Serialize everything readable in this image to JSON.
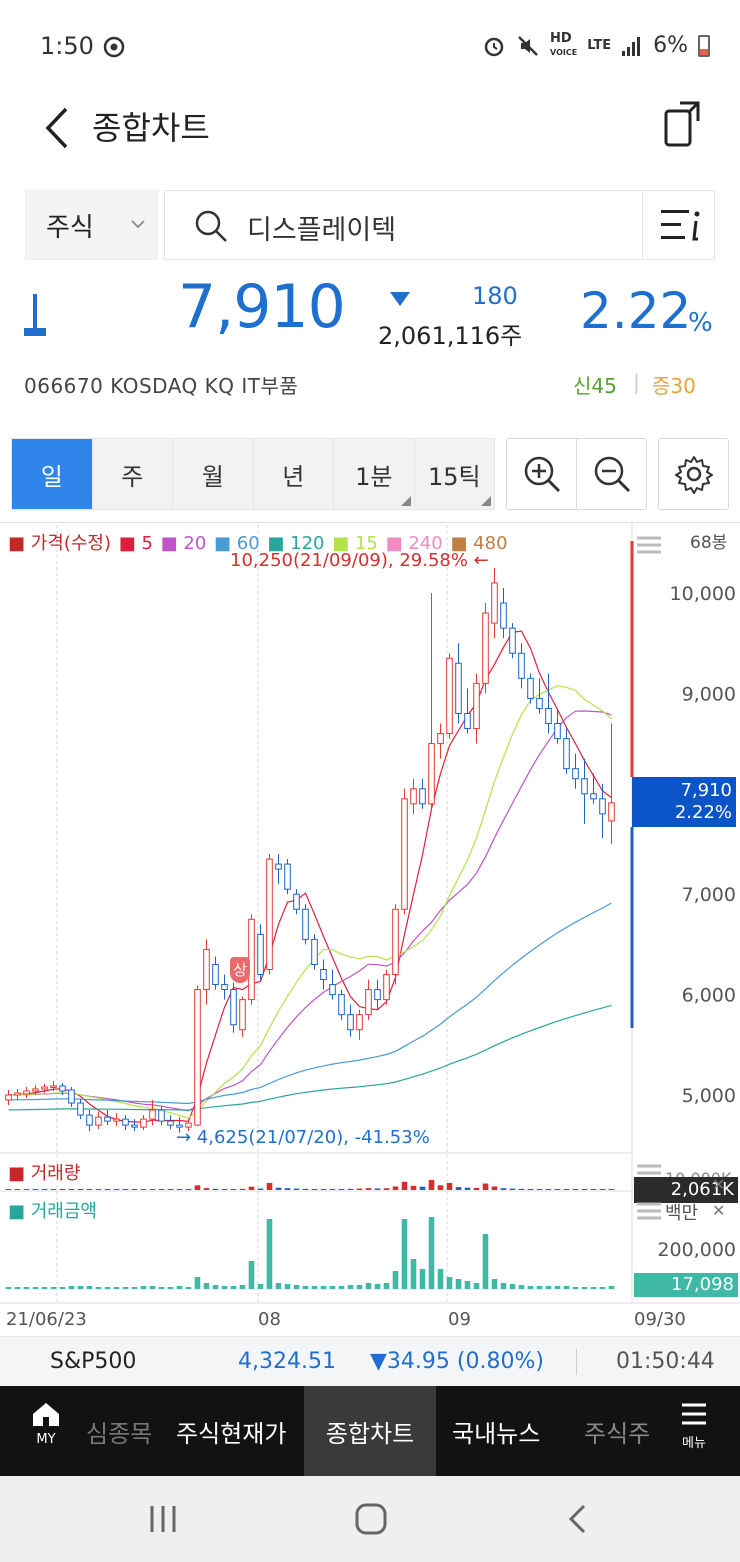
{
  "status_bar": {
    "time": "1:50",
    "battery": "6%",
    "network": "LTE"
  },
  "header": {
    "title": "종합차트"
  },
  "search": {
    "type_label": "주식",
    "query": "디스플레이텍"
  },
  "quote": {
    "price": "7,910",
    "change": "180",
    "volume": "2,061,116주",
    "percent": "2.22",
    "percent_sign": "%",
    "code_line": "066670  KOSDAQ  KQ IT부품",
    "new_high": "신45",
    "divider": "|",
    "margin": "증30"
  },
  "period_tabs": [
    {
      "label": "일",
      "active": true
    },
    {
      "label": "주"
    },
    {
      "label": "월"
    },
    {
      "label": "년"
    },
    {
      "label": "1분",
      "corner": true
    },
    {
      "label": "15틱",
      "corner": true
    }
  ],
  "chart_labels": {
    "legend": [
      {
        "text": "■ 가격(수정)",
        "color": "#c62828"
      },
      {
        "text": "■ 5",
        "color": "#e01e3c"
      },
      {
        "text": "■ 20",
        "color": "#c054c8"
      },
      {
        "text": "■ 60",
        "color": "#4a9ad4"
      },
      {
        "text": "■ 120",
        "color": "#27a79b"
      },
      {
        "text": "■ 15",
        "color": "#b3e34a"
      },
      {
        "text": "■ 240",
        "color": "#f08bc4"
      },
      {
        "text": "■ 480",
        "color": "#c08040"
      }
    ],
    "bong_count": "68봉",
    "high_annotation": "10,250(21/09/09), 29.58%  ←",
    "low_annotation": "→  4,625(21/07/20), -41.53%",
    "limit_up_badge": "상",
    "volume_label": "■ 거래량",
    "amount_label": "■ 거래금액",
    "amount_unit": "백만",
    "vol_axis_partial": "10,000K",
    "current_price_tag": "7,910",
    "current_pct_tag": "2.22%",
    "current_vol_tag": "2,061K",
    "current_amt_tag": "17,098",
    "x_labels": [
      "21/06/23",
      "08",
      "09",
      "09/30"
    ]
  },
  "chart_data": {
    "type": "candlestick",
    "title": "",
    "ylim": [
      4500,
      10500
    ],
    "yticks": [
      5000,
      6000,
      7000,
      8000,
      9000,
      10000
    ],
    "ytick_labels": [
      "5,000",
      "6,000",
      "7,000",
      "",
      "9,000",
      "10,000"
    ],
    "amount_ticks": [
      200000
    ],
    "amount_tick_labels": [
      "200,000"
    ],
    "candles": [
      [
        4950,
        5050,
        4900,
        5000
      ],
      [
        5000,
        5060,
        4950,
        5020
      ],
      [
        5010,
        5080,
        4970,
        5040
      ],
      [
        5040,
        5100,
        5000,
        5060
      ],
      [
        5060,
        5110,
        5020,
        5080
      ],
      [
        5080,
        5140,
        5040,
        5090
      ],
      [
        5090,
        5120,
        5000,
        5040
      ],
      [
        5050,
        5080,
        4880,
        4920
      ],
      [
        4920,
        4960,
        4760,
        4800
      ],
      [
        4800,
        4850,
        4640,
        4700
      ],
      [
        4700,
        4830,
        4660,
        4780
      ],
      [
        4780,
        4850,
        4700,
        4740
      ],
      [
        4740,
        4820,
        4690,
        4760
      ],
      [
        4760,
        4800,
        4650,
        4700
      ],
      [
        4700,
        4760,
        4640,
        4680
      ],
      [
        4680,
        4800,
        4650,
        4760
      ],
      [
        4760,
        4950,
        4700,
        4850
      ],
      [
        4850,
        4880,
        4700,
        4740
      ],
      [
        4740,
        4800,
        4660,
        4700
      ],
      [
        4700,
        4780,
        4625,
        4680
      ],
      [
        4680,
        4760,
        4640,
        4720
      ],
      [
        4700,
        6090,
        4690,
        6050
      ],
      [
        6050,
        6550,
        5900,
        6450
      ],
      [
        6300,
        6380,
        6050,
        6100
      ],
      [
        6100,
        6200,
        5950,
        6050
      ],
      [
        6050,
        6120,
        5620,
        5700
      ],
      [
        5650,
        5980,
        5580,
        5950
      ],
      [
        5950,
        6800,
        5900,
        6750
      ],
      [
        6600,
        6700,
        6150,
        6200
      ],
      [
        6250,
        7400,
        6200,
        7350
      ],
      [
        7300,
        7400,
        7100,
        7250
      ],
      [
        7300,
        7350,
        7000,
        7050
      ],
      [
        7000,
        7050,
        6800,
        6850
      ],
      [
        6850,
        6900,
        6500,
        6550
      ],
      [
        6550,
        6600,
        6250,
        6300
      ],
      [
        6250,
        6350,
        6050,
        6150
      ],
      [
        6100,
        6250,
        5950,
        6000
      ],
      [
        6000,
        6050,
        5750,
        5800
      ],
      [
        5800,
        5900,
        5580,
        5650
      ],
      [
        5650,
        5850,
        5550,
        5800
      ],
      [
        5800,
        6150,
        5750,
        6050
      ],
      [
        6050,
        6150,
        5850,
        5950
      ],
      [
        5950,
        6250,
        5900,
        6200
      ],
      [
        6200,
        6900,
        6100,
        6850
      ],
      [
        6850,
        8050,
        6800,
        7950
      ],
      [
        7900,
        8150,
        7800,
        8050
      ],
      [
        8050,
        8150,
        7850,
        7900
      ],
      [
        7900,
        10000,
        7850,
        8500
      ],
      [
        8500,
        8700,
        8350,
        8600
      ],
      [
        8600,
        9400,
        8550,
        9350
      ],
      [
        9300,
        9500,
        8700,
        8800
      ],
      [
        8800,
        9050,
        8600,
        8650
      ],
      [
        8650,
        9200,
        8500,
        9100
      ],
      [
        9100,
        9900,
        9000,
        9800
      ],
      [
        9700,
        10250,
        9550,
        10100
      ],
      [
        9900,
        10050,
        9550,
        9650
      ],
      [
        9650,
        9700,
        9350,
        9400
      ],
      [
        9400,
        9500,
        9050,
        9150
      ],
      [
        9150,
        9200,
        8900,
        8950
      ],
      [
        8950,
        9150,
        8800,
        8850
      ],
      [
        8850,
        9200,
        8600,
        8700
      ],
      [
        8700,
        8850,
        8500,
        8550
      ],
      [
        8550,
        8650,
        8200,
        8250
      ],
      [
        8250,
        8400,
        8050,
        8150
      ],
      [
        8150,
        8350,
        7700,
        8000
      ],
      [
        8000,
        8200,
        7900,
        7950
      ],
      [
        7950,
        8100,
        7560,
        7800
      ],
      [
        7730,
        8700,
        7500,
        7910
      ]
    ],
    "volume_relative": [
      2,
      2,
      2,
      2,
      3,
      3,
      3,
      4,
      5,
      4,
      3,
      3,
      3,
      3,
      3,
      4,
      4,
      3,
      3,
      4,
      3,
      40,
      16,
      10,
      8,
      8,
      10,
      28,
      12,
      60,
      20,
      16,
      12,
      10,
      9,
      8,
      9,
      9,
      10,
      12,
      16,
      13,
      15,
      30,
      70,
      35,
      28,
      85,
      40,
      60,
      25,
      20,
      18,
      55,
      30,
      15,
      12,
      10,
      9,
      8,
      7,
      8,
      8,
      7,
      7,
      6,
      6,
      8
    ],
    "amount_relative": [
      2,
      2,
      2,
      2,
      2,
      2,
      2,
      3,
      3,
      3,
      2,
      2,
      2,
      2,
      2,
      3,
      3,
      2,
      2,
      3,
      2,
      12,
      6,
      4,
      3,
      3,
      4,
      28,
      5,
      70,
      6,
      5,
      4,
      3,
      3,
      3,
      3,
      3,
      4,
      4,
      6,
      5,
      6,
      18,
      70,
      30,
      20,
      72,
      20,
      12,
      10,
      8,
      6,
      55,
      10,
      6,
      5,
      4,
      3,
      3,
      3,
      3,
      3,
      2,
      2,
      2,
      2,
      3
    ],
    "series": [
      {
        "name": "5",
        "color": "#e01e3c"
      },
      {
        "name": "20",
        "color": "#c054c8"
      },
      {
        "name": "60",
        "color": "#4a9ad4"
      },
      {
        "name": "120",
        "color": "#27a79b"
      },
      {
        "name": "15",
        "color": "#b3e34a"
      }
    ]
  },
  "ticker": {
    "name": "S&P500",
    "value": "4,324.51",
    "change": "▼34.95 (0.80%)",
    "time": "01:50:44"
  },
  "bottom_menu": {
    "home_label": "MY",
    "items": [
      "심종목",
      "주식현재가",
      "종합차트",
      "국내뉴스",
      "주식주"
    ],
    "active_index": 2,
    "more_label": "메뉴"
  }
}
